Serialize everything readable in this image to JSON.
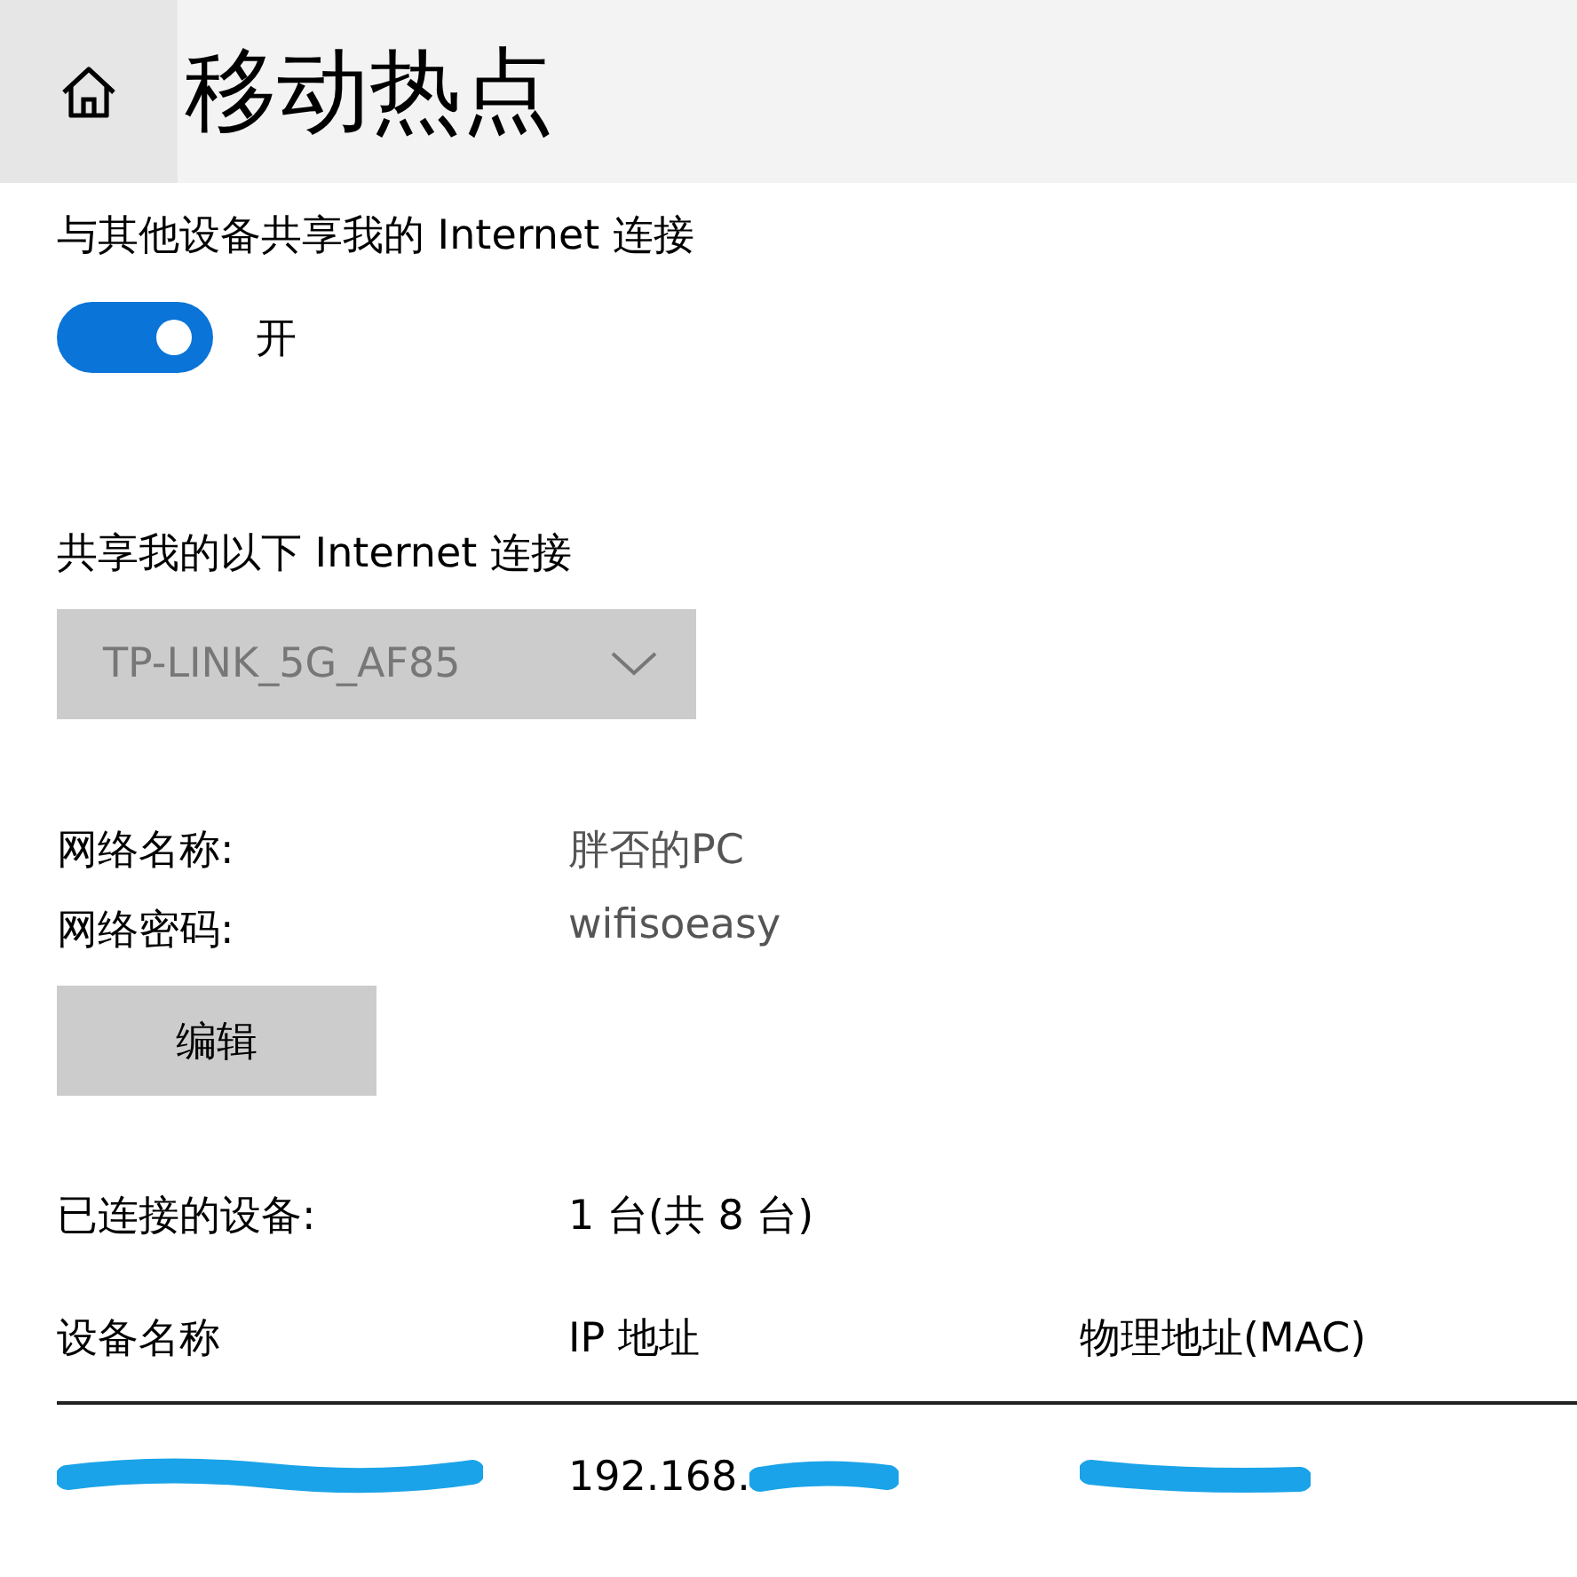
{
  "header": {
    "title": "移动热点"
  },
  "share": {
    "label": "与其他设备共享我的 Internet 连接",
    "on": true,
    "state_text": "开"
  },
  "source": {
    "label": "共享我的以下 Internet 连接",
    "value": "TP-LINK_5G_AF85",
    "disabled": true
  },
  "network": [
    {
      "label": "网络名称:",
      "value": "胖否的PC"
    },
    {
      "label": "网络密码:",
      "value": "wifisoeasy"
    }
  ],
  "edit_button": "编辑",
  "connected": {
    "label": "已连接的设备:",
    "value": "1 台(共 8 台)"
  },
  "table": {
    "columns": [
      "设备名称",
      "IP 地址",
      "物理地址(MAC)"
    ],
    "rows": [
      {
        "ip": "192.168."
      }
    ]
  }
}
